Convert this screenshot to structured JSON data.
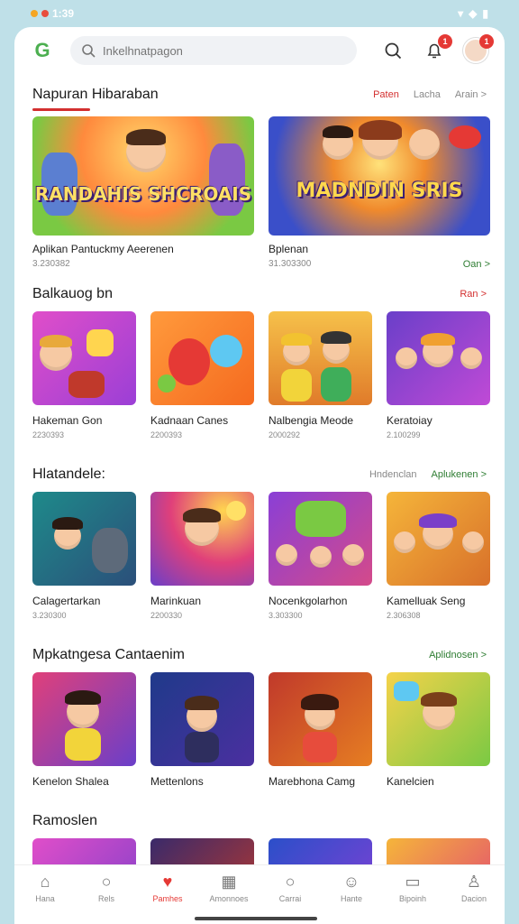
{
  "status": {
    "time": "1:39"
  },
  "search": {
    "placeholder": "Inkelhnatpagon"
  },
  "header": {
    "bell_badge": "1",
    "avatar_badge": "1"
  },
  "featured": {
    "title": "Napuran Hibaraban",
    "links": [
      "Paten",
      "Lacha",
      "Arain >"
    ],
    "items": [
      {
        "art": "RANDAHIS SHCROAIS",
        "title": "Aplikan Pantuckmy Aeerenen",
        "sub": "3.230382",
        "cta": ""
      },
      {
        "art": "MADNDIN SRIS",
        "title": "Bplenan",
        "sub": "31.303300",
        "cta": "Oan >"
      }
    ]
  },
  "section1": {
    "title": "Balkauog bn",
    "link": "Ran >",
    "cards": [
      {
        "title": "Hakeman Gon",
        "sub": "2230393"
      },
      {
        "title": "Kadnaan Canes",
        "sub": "2200393"
      },
      {
        "title": "Nalbengia Meode",
        "sub": "2000292"
      },
      {
        "title": "Keratoiay",
        "sub": "2.100299"
      }
    ]
  },
  "section2": {
    "title": "Hlatandele:",
    "links": [
      "Hndenclan",
      "Aplukenen >"
    ],
    "cards": [
      {
        "title": "Calagertarkan",
        "sub": "3.230300"
      },
      {
        "title": "Marinkuan",
        "sub": "2200330"
      },
      {
        "title": "Nocenkgolarhon",
        "sub": "3.303300"
      },
      {
        "title": "Kamelluak Seng",
        "sub": "2.306308"
      }
    ]
  },
  "section3": {
    "title": "Mpkatngesa Cantaenim",
    "link": "Aplidnosen >",
    "cards": [
      {
        "title": "Kenelon Shalea",
        "sub": ""
      },
      {
        "title": "Mettenlons",
        "sub": ""
      },
      {
        "title": "Marebhona Camg",
        "sub": ""
      },
      {
        "title": "Kanelcien",
        "sub": ""
      }
    ]
  },
  "section4": {
    "title": "Ramoslen"
  },
  "nav": [
    {
      "label": "Hana",
      "icon": "home-icon"
    },
    {
      "label": "Rels",
      "icon": "search-icon"
    },
    {
      "label": "Pamhes",
      "icon": "games-icon"
    },
    {
      "label": "Amonnoes",
      "icon": "grid-icon"
    },
    {
      "label": "Carrai",
      "icon": "search-icon"
    },
    {
      "label": "Hante",
      "icon": "people-icon"
    },
    {
      "label": "Bipoinh",
      "icon": "book-icon"
    },
    {
      "label": "Dacion",
      "icon": "account-icon"
    }
  ],
  "colors": {
    "accent": "#d32f2f",
    "green": "#2e7d32",
    "background": "#bfe0e8"
  }
}
